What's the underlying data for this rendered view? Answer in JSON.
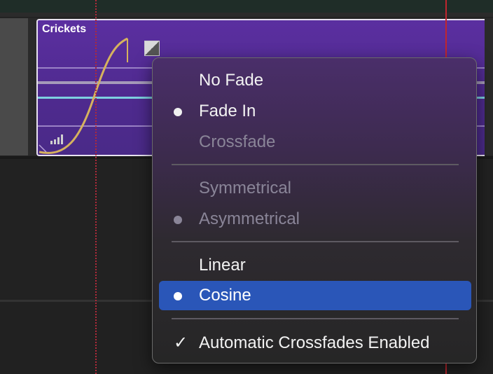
{
  "region": {
    "name": "Crickets"
  },
  "menu": {
    "items": [
      {
        "label": "No Fade",
        "mark": "none",
        "state": "enabled"
      },
      {
        "label": "Fade In",
        "mark": "bullet",
        "state": "enabled"
      },
      {
        "label": "Crossfade",
        "mark": "none",
        "state": "disabled"
      },
      {
        "label": "Symmetrical",
        "mark": "none",
        "state": "disabled"
      },
      {
        "label": "Asymmetrical",
        "mark": "bullet",
        "state": "disabled"
      },
      {
        "label": "Linear",
        "mark": "none",
        "state": "enabled"
      },
      {
        "label": "Cosine",
        "mark": "bullet",
        "state": "highlighted"
      },
      {
        "label": "Automatic Crossfades Enabled",
        "mark": "check",
        "state": "enabled"
      }
    ],
    "check_glyph": "✓"
  },
  "colors": {
    "region": "#5b2fa0",
    "highlight": "#2a56b8",
    "playhead": "#c0262e",
    "fade_curve": "#d6b25e"
  }
}
